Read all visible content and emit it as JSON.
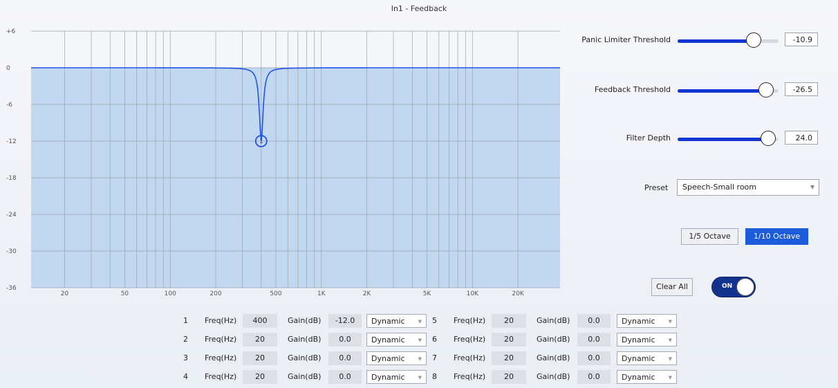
{
  "window": {
    "title": "In1 - Feedback"
  },
  "graph": {
    "y_ticks": [
      "+6",
      "0",
      "-6",
      "-12",
      "-18",
      "-24",
      "-30",
      "-36"
    ],
    "x_ticks": [
      "20",
      "50",
      "100",
      "200",
      "500",
      "1K",
      "2K",
      "5K",
      "10K",
      "20K"
    ],
    "active_filter_marker": "1",
    "colors": {
      "curve": "#1f52e6",
      "fill": "#c2d8f0",
      "grid": "#9aa3ad"
    }
  },
  "controls": {
    "panic": {
      "label": "Panic Limiter Threshold",
      "value": "-10.9",
      "level": 0.75
    },
    "feedback": {
      "label": "Feedback Threshold",
      "value": "-26.5",
      "level": 0.88
    },
    "depth": {
      "label": "Filter Depth",
      "value": "24.0",
      "level": 0.9
    },
    "preset": {
      "label": "Preset",
      "value": "Speech-Small room"
    },
    "octave_buttons": {
      "fifth": "1/5 Octave",
      "tenth": "1/10 Octave",
      "selected": "1/10 Octave"
    },
    "clear_all": "Clear All",
    "toggle": {
      "label": "ON",
      "state": "on"
    }
  },
  "filters": {
    "freq_label": "Freq(Hz)",
    "gain_label": "Gain(dB)",
    "rows": [
      {
        "index": "1",
        "freq": "400",
        "gain": "-12.0",
        "mode": "Dynamic"
      },
      {
        "index": "2",
        "freq": "20",
        "gain": "0.0",
        "mode": "Dynamic"
      },
      {
        "index": "3",
        "freq": "20",
        "gain": "0.0",
        "mode": "Dynamic"
      },
      {
        "index": "4",
        "freq": "20",
        "gain": "0.0",
        "mode": "Dynamic"
      },
      {
        "index": "5",
        "freq": "20",
        "gain": "0.0",
        "mode": "Dynamic"
      },
      {
        "index": "6",
        "freq": "20",
        "gain": "0.0",
        "mode": "Dynamic"
      },
      {
        "index": "7",
        "freq": "20",
        "gain": "0.0",
        "mode": "Dynamic"
      },
      {
        "index": "8",
        "freq": "20",
        "gain": "0.0",
        "mode": "Dynamic"
      }
    ]
  }
}
